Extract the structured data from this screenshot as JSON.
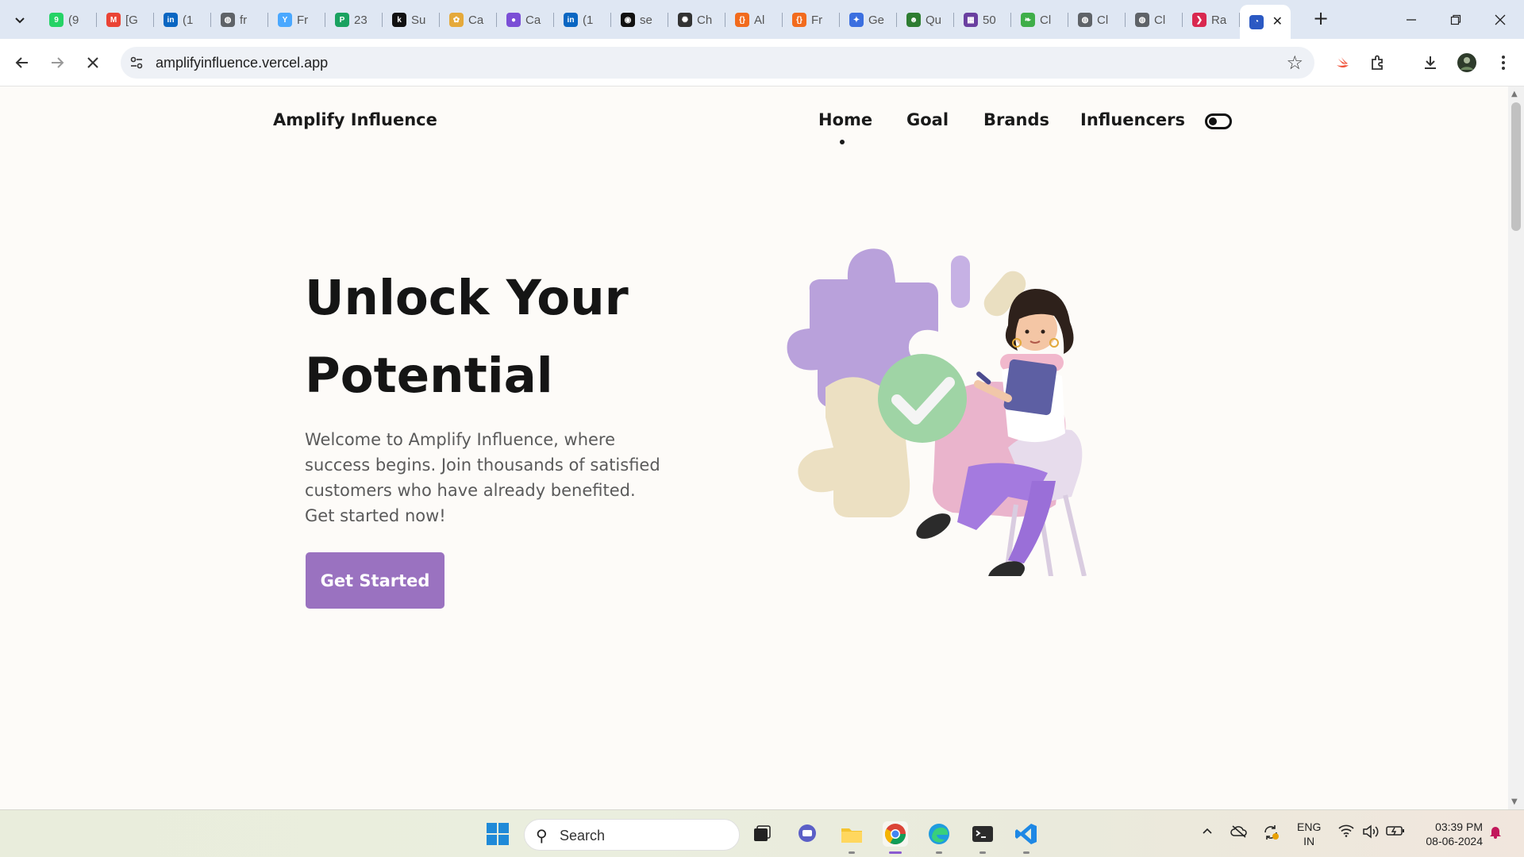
{
  "browser": {
    "tabs": [
      {
        "title": "(9",
        "icon": "whatsapp-icon",
        "color": "#25d366",
        "glyph": "9"
      },
      {
        "title": "[G",
        "icon": "gmail-icon",
        "color": "#ea4335",
        "glyph": "M"
      },
      {
        "title": "(1",
        "icon": "linkedin-icon",
        "color": "#0a66c2",
        "glyph": "in"
      },
      {
        "title": "fr",
        "icon": "globe-icon",
        "color": "#5f6368",
        "glyph": "◍"
      },
      {
        "title": "Fr",
        "icon": "figma-icon",
        "color": "#4aa8ff",
        "glyph": "Y"
      },
      {
        "title": "23",
        "icon": "spreadsheet-icon",
        "color": "#1aa260",
        "glyph": "P"
      },
      {
        "title": "Su",
        "icon": "k-icon",
        "color": "#111111",
        "glyph": "k"
      },
      {
        "title": "Ca",
        "icon": "pinwheel-icon",
        "color": "#e5a93a",
        "glyph": "✿"
      },
      {
        "title": "Ca",
        "icon": "profile-icon",
        "color": "#7b4fd6",
        "glyph": "●"
      },
      {
        "title": "(1",
        "icon": "linkedin-icon",
        "color": "#0a66c2",
        "glyph": "in"
      },
      {
        "title": "se",
        "icon": "github-icon",
        "color": "#111111",
        "glyph": "◉"
      },
      {
        "title": "Ch",
        "icon": "openai-icon",
        "color": "#333333",
        "glyph": "✺"
      },
      {
        "title": "Al",
        "icon": "code-icon",
        "color": "#f26b1d",
        "glyph": "{}"
      },
      {
        "title": "Fr",
        "icon": "code-icon",
        "color": "#f26b1d",
        "glyph": "{}"
      },
      {
        "title": "Ge",
        "icon": "gemini-icon",
        "color": "#3b6fe0",
        "glyph": "✦"
      },
      {
        "title": "Qu",
        "icon": "robot-icon",
        "color": "#2e7d32",
        "glyph": "☻"
      },
      {
        "title": "50",
        "icon": "colorful-icon",
        "color": "#6a3fa0",
        "glyph": "▦"
      },
      {
        "title": "Cl",
        "icon": "leaf-icon",
        "color": "#3fae49",
        "glyph": "❧"
      },
      {
        "title": "Cl",
        "icon": "globe-icon",
        "color": "#5f6368",
        "glyph": "◍"
      },
      {
        "title": "Cl",
        "icon": "globe-icon",
        "color": "#5f6368",
        "glyph": "◍"
      },
      {
        "title": "Ra",
        "icon": "react-icon",
        "color": "#d9284f",
        "glyph": "❯"
      },
      {
        "title": "",
        "icon": "loading-icon",
        "color": "#2b59c3",
        "glyph": "◔",
        "active": true
      }
    ],
    "url": "amplifyinfluence.vercel.app"
  },
  "page": {
    "brand": "Amplify Influence",
    "nav": {
      "home": "Home",
      "goal": "Goal",
      "brands": "Brands",
      "influencers": "Influencers"
    },
    "hero": {
      "title_line1": "Unlock Your",
      "title_line2": "Potential",
      "description": "Welcome to Amplify Influence, where success begins. Join thousands of satisfied customers who have already benefited. Get started now!",
      "cta": "Get Started"
    },
    "colors": {
      "accent": "#9a72c0",
      "background": "#fdfbf8"
    }
  },
  "taskbar": {
    "search_placeholder": "Search",
    "language_line1": "ENG",
    "language_line2": "IN",
    "time": "03:39 PM",
    "date": "08-06-2024"
  }
}
